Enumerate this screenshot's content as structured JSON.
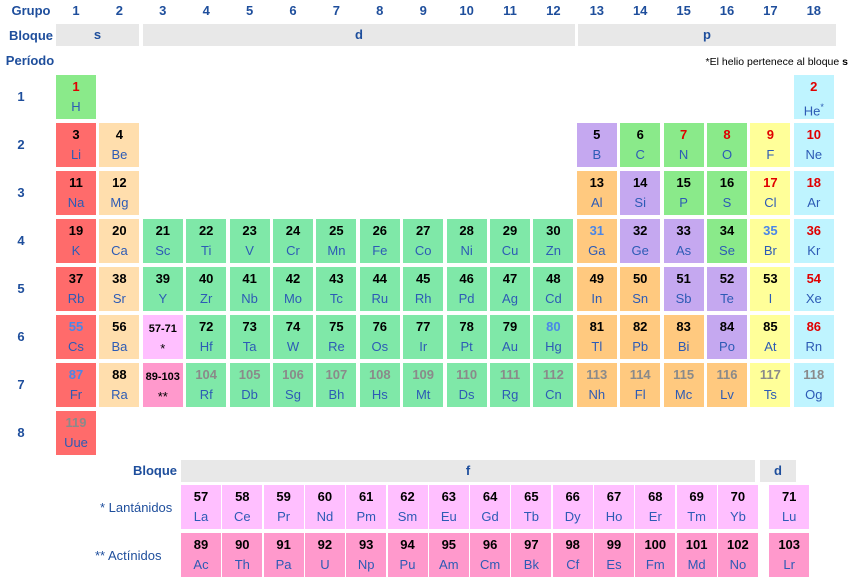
{
  "headers": {
    "group": "Grupo",
    "block": "Bloque",
    "period": "Período"
  },
  "groups": [
    "1",
    "2",
    "3",
    "4",
    "5",
    "6",
    "7",
    "8",
    "9",
    "10",
    "11",
    "12",
    "13",
    "14",
    "15",
    "16",
    "17",
    "18"
  ],
  "periods": [
    "1",
    "2",
    "3",
    "4",
    "5",
    "6",
    "7",
    "8"
  ],
  "blocks": {
    "s": "s",
    "d": "d",
    "p": "p",
    "f": "f",
    "d2": "d"
  },
  "note": {
    "mark": "*",
    "text": "El helio pertenece al bloque ",
    "block": "s"
  },
  "series_labels": {
    "lanthanides": "* Lantánidos",
    "actinides": "**  Actínidos",
    "block": "Bloque"
  },
  "colors": {
    "alkali": "#ff6b6b",
    "alkaline_earth": "#ffdead",
    "transition": "#7fe8a8",
    "post_transition": "#ffc97f",
    "metalloid": "#c5a8f0",
    "nonmetal": "#8aea8a",
    "halogen": "#ffff99",
    "noble_gas": "#bff4ff",
    "lanthanide": "#ffbfff",
    "actinide": "#ff99cc"
  },
  "elements": [
    {
      "n": "1",
      "s": "H",
      "p": 1,
      "g": 1,
      "c": "nm",
      "t": "red"
    },
    {
      "n": "2",
      "s": "He",
      "p": 1,
      "g": 18,
      "c": "ng",
      "t": "red",
      "mark": "*"
    },
    {
      "n": "3",
      "s": "Li",
      "p": 2,
      "g": 1,
      "c": "alk"
    },
    {
      "n": "4",
      "s": "Be",
      "p": 2,
      "g": 2,
      "c": "ae"
    },
    {
      "n": "5",
      "s": "B",
      "p": 2,
      "g": 13,
      "c": "md"
    },
    {
      "n": "6",
      "s": "C",
      "p": 2,
      "g": 14,
      "c": "nm"
    },
    {
      "n": "7",
      "s": "N",
      "p": 2,
      "g": 15,
      "c": "nm",
      "t": "red"
    },
    {
      "n": "8",
      "s": "O",
      "p": 2,
      "g": 16,
      "c": "nm",
      "t": "red"
    },
    {
      "n": "9",
      "s": "F",
      "p": 2,
      "g": 17,
      "c": "hal",
      "t": "red"
    },
    {
      "n": "10",
      "s": "Ne",
      "p": 2,
      "g": 18,
      "c": "ng",
      "t": "red"
    },
    {
      "n": "11",
      "s": "Na",
      "p": 3,
      "g": 1,
      "c": "alk"
    },
    {
      "n": "12",
      "s": "Mg",
      "p": 3,
      "g": 2,
      "c": "ae"
    },
    {
      "n": "13",
      "s": "Al",
      "p": 3,
      "g": 13,
      "c": "pm"
    },
    {
      "n": "14",
      "s": "Si",
      "p": 3,
      "g": 14,
      "c": "md"
    },
    {
      "n": "15",
      "s": "P",
      "p": 3,
      "g": 15,
      "c": "nm"
    },
    {
      "n": "16",
      "s": "S",
      "p": 3,
      "g": 16,
      "c": "nm"
    },
    {
      "n": "17",
      "s": "Cl",
      "p": 3,
      "g": 17,
      "c": "hal",
      "t": "red"
    },
    {
      "n": "18",
      "s": "Ar",
      "p": 3,
      "g": 18,
      "c": "ng",
      "t": "red"
    },
    {
      "n": "19",
      "s": "K",
      "p": 4,
      "g": 1,
      "c": "alk"
    },
    {
      "n": "20",
      "s": "Ca",
      "p": 4,
      "g": 2,
      "c": "ae"
    },
    {
      "n": "21",
      "s": "Sc",
      "p": 4,
      "g": 3,
      "c": "tm"
    },
    {
      "n": "22",
      "s": "Ti",
      "p": 4,
      "g": 4,
      "c": "tm"
    },
    {
      "n": "23",
      "s": "V",
      "p": 4,
      "g": 5,
      "c": "tm"
    },
    {
      "n": "24",
      "s": "Cr",
      "p": 4,
      "g": 6,
      "c": "tm"
    },
    {
      "n": "25",
      "s": "Mn",
      "p": 4,
      "g": 7,
      "c": "tm"
    },
    {
      "n": "26",
      "s": "Fe",
      "p": 4,
      "g": 8,
      "c": "tm"
    },
    {
      "n": "27",
      "s": "Co",
      "p": 4,
      "g": 9,
      "c": "tm"
    },
    {
      "n": "28",
      "s": "Ni",
      "p": 4,
      "g": 10,
      "c": "tm"
    },
    {
      "n": "29",
      "s": "Cu",
      "p": 4,
      "g": 11,
      "c": "tm"
    },
    {
      "n": "30",
      "s": "Zn",
      "p": 4,
      "g": 12,
      "c": "tm"
    },
    {
      "n": "31",
      "s": "Ga",
      "p": 4,
      "g": 13,
      "c": "pm",
      "t": "blue"
    },
    {
      "n": "32",
      "s": "Ge",
      "p": 4,
      "g": 14,
      "c": "md"
    },
    {
      "n": "33",
      "s": "As",
      "p": 4,
      "g": 15,
      "c": "md"
    },
    {
      "n": "34",
      "s": "Se",
      "p": 4,
      "g": 16,
      "c": "nm"
    },
    {
      "n": "35",
      "s": "Br",
      "p": 4,
      "g": 17,
      "c": "hal",
      "t": "blue"
    },
    {
      "n": "36",
      "s": "Kr",
      "p": 4,
      "g": 18,
      "c": "ng",
      "t": "red"
    },
    {
      "n": "37",
      "s": "Rb",
      "p": 5,
      "g": 1,
      "c": "alk"
    },
    {
      "n": "38",
      "s": "Sr",
      "p": 5,
      "g": 2,
      "c": "ae"
    },
    {
      "n": "39",
      "s": "Y",
      "p": 5,
      "g": 3,
      "c": "tm"
    },
    {
      "n": "40",
      "s": "Zr",
      "p": 5,
      "g": 4,
      "c": "tm"
    },
    {
      "n": "41",
      "s": "Nb",
      "p": 5,
      "g": 5,
      "c": "tm"
    },
    {
      "n": "42",
      "s": "Mo",
      "p": 5,
      "g": 6,
      "c": "tm"
    },
    {
      "n": "43",
      "s": "Tc",
      "p": 5,
      "g": 7,
      "c": "tm"
    },
    {
      "n": "44",
      "s": "Ru",
      "p": 5,
      "g": 8,
      "c": "tm"
    },
    {
      "n": "45",
      "s": "Rh",
      "p": 5,
      "g": 9,
      "c": "tm"
    },
    {
      "n": "46",
      "s": "Pd",
      "p": 5,
      "g": 10,
      "c": "tm"
    },
    {
      "n": "47",
      "s": "Ag",
      "p": 5,
      "g": 11,
      "c": "tm"
    },
    {
      "n": "48",
      "s": "Cd",
      "p": 5,
      "g": 12,
      "c": "tm"
    },
    {
      "n": "49",
      "s": "In",
      "p": 5,
      "g": 13,
      "c": "pm"
    },
    {
      "n": "50",
      "s": "Sn",
      "p": 5,
      "g": 14,
      "c": "pm"
    },
    {
      "n": "51",
      "s": "Sb",
      "p": 5,
      "g": 15,
      "c": "md"
    },
    {
      "n": "52",
      "s": "Te",
      "p": 5,
      "g": 16,
      "c": "md"
    },
    {
      "n": "53",
      "s": "I",
      "p": 5,
      "g": 17,
      "c": "hal"
    },
    {
      "n": "54",
      "s": "Xe",
      "p": 5,
      "g": 18,
      "c": "ng",
      "t": "red"
    },
    {
      "n": "55",
      "s": "Cs",
      "p": 6,
      "g": 1,
      "c": "alk",
      "t": "blue"
    },
    {
      "n": "56",
      "s": "Ba",
      "p": 6,
      "g": 2,
      "c": "ae"
    },
    {
      "n": "57-71",
      "s": "*",
      "p": 6,
      "g": 3,
      "c": "ph",
      "ph": true
    },
    {
      "n": "72",
      "s": "Hf",
      "p": 6,
      "g": 4,
      "c": "tm"
    },
    {
      "n": "73",
      "s": "Ta",
      "p": 6,
      "g": 5,
      "c": "tm"
    },
    {
      "n": "74",
      "s": "W",
      "p": 6,
      "g": 6,
      "c": "tm"
    },
    {
      "n": "75",
      "s": "Re",
      "p": 6,
      "g": 7,
      "c": "tm"
    },
    {
      "n": "76",
      "s": "Os",
      "p": 6,
      "g": 8,
      "c": "tm"
    },
    {
      "n": "77",
      "s": "Ir",
      "p": 6,
      "g": 9,
      "c": "tm"
    },
    {
      "n": "78",
      "s": "Pt",
      "p": 6,
      "g": 10,
      "c": "tm"
    },
    {
      "n": "79",
      "s": "Au",
      "p": 6,
      "g": 11,
      "c": "tm"
    },
    {
      "n": "80",
      "s": "Hg",
      "p": 6,
      "g": 12,
      "c": "tm",
      "t": "blue"
    },
    {
      "n": "81",
      "s": "Tl",
      "p": 6,
      "g": 13,
      "c": "pm"
    },
    {
      "n": "82",
      "s": "Pb",
      "p": 6,
      "g": 14,
      "c": "pm"
    },
    {
      "n": "83",
      "s": "Bi",
      "p": 6,
      "g": 15,
      "c": "pm"
    },
    {
      "n": "84",
      "s": "Po",
      "p": 6,
      "g": 16,
      "c": "md"
    },
    {
      "n": "85",
      "s": "At",
      "p": 6,
      "g": 17,
      "c": "hal"
    },
    {
      "n": "86",
      "s": "Rn",
      "p": 6,
      "g": 18,
      "c": "ng",
      "t": "red"
    },
    {
      "n": "87",
      "s": "Fr",
      "p": 7,
      "g": 1,
      "c": "alk",
      "t": "blue"
    },
    {
      "n": "88",
      "s": "Ra",
      "p": 7,
      "g": 2,
      "c": "ae"
    },
    {
      "n": "89-103",
      "s": "**",
      "p": 7,
      "g": 3,
      "c": "ph2",
      "ph": true
    },
    {
      "n": "104",
      "s": "Rf",
      "p": 7,
      "g": 4,
      "c": "tm",
      "t": "gray"
    },
    {
      "n": "105",
      "s": "Db",
      "p": 7,
      "g": 5,
      "c": "tm",
      "t": "gray"
    },
    {
      "n": "106",
      "s": "Sg",
      "p": 7,
      "g": 6,
      "c": "tm",
      "t": "gray"
    },
    {
      "n": "107",
      "s": "Bh",
      "p": 7,
      "g": 7,
      "c": "tm",
      "t": "gray"
    },
    {
      "n": "108",
      "s": "Hs",
      "p": 7,
      "g": 8,
      "c": "tm",
      "t": "gray"
    },
    {
      "n": "109",
      "s": "Mt",
      "p": 7,
      "g": 9,
      "c": "tm",
      "t": "gray"
    },
    {
      "n": "110",
      "s": "Ds",
      "p": 7,
      "g": 10,
      "c": "tm",
      "t": "gray"
    },
    {
      "n": "111",
      "s": "Rg",
      "p": 7,
      "g": 11,
      "c": "tm",
      "t": "gray"
    },
    {
      "n": "112",
      "s": "Cn",
      "p": 7,
      "g": 12,
      "c": "tm",
      "t": "gray"
    },
    {
      "n": "113",
      "s": "Nh",
      "p": 7,
      "g": 13,
      "c": "pm",
      "t": "gray"
    },
    {
      "n": "114",
      "s": "Fl",
      "p": 7,
      "g": 14,
      "c": "pm",
      "t": "gray"
    },
    {
      "n": "115",
      "s": "Mc",
      "p": 7,
      "g": 15,
      "c": "pm",
      "t": "gray"
    },
    {
      "n": "116",
      "s": "Lv",
      "p": 7,
      "g": 16,
      "c": "pm",
      "t": "gray"
    },
    {
      "n": "117",
      "s": "Ts",
      "p": 7,
      "g": 17,
      "c": "hal",
      "t": "gray"
    },
    {
      "n": "118",
      "s": "Og",
      "p": 7,
      "g": 18,
      "c": "ng",
      "t": "gray"
    },
    {
      "n": "119",
      "s": "Uue",
      "p": 8,
      "g": 1,
      "c": "alk",
      "t": "gray"
    }
  ],
  "lanthanides": [
    {
      "n": "57",
      "s": "La"
    },
    {
      "n": "58",
      "s": "Ce"
    },
    {
      "n": "59",
      "s": "Pr"
    },
    {
      "n": "60",
      "s": "Nd"
    },
    {
      "n": "61",
      "s": "Pm"
    },
    {
      "n": "62",
      "s": "Sm"
    },
    {
      "n": "63",
      "s": "Eu"
    },
    {
      "n": "64",
      "s": "Gd"
    },
    {
      "n": "65",
      "s": "Tb"
    },
    {
      "n": "66",
      "s": "Dy"
    },
    {
      "n": "67",
      "s": "Ho"
    },
    {
      "n": "68",
      "s": "Er"
    },
    {
      "n": "69",
      "s": "Tm"
    },
    {
      "n": "70",
      "s": "Yb"
    },
    {
      "n": "71",
      "s": "Lu"
    }
  ],
  "actinides": [
    {
      "n": "89",
      "s": "Ac"
    },
    {
      "n": "90",
      "s": "Th"
    },
    {
      "n": "91",
      "s": "Pa"
    },
    {
      "n": "92",
      "s": "U"
    },
    {
      "n": "93",
      "s": "Np"
    },
    {
      "n": "94",
      "s": "Pu"
    },
    {
      "n": "95",
      "s": "Am"
    },
    {
      "n": "96",
      "s": "Cm"
    },
    {
      "n": "97",
      "s": "Bk"
    },
    {
      "n": "98",
      "s": "Cf"
    },
    {
      "n": "99",
      "s": "Es"
    },
    {
      "n": "100",
      "s": "Fm"
    },
    {
      "n": "101",
      "s": "Md"
    },
    {
      "n": "102",
      "s": "No"
    },
    {
      "n": "103",
      "s": "Lr"
    }
  ]
}
